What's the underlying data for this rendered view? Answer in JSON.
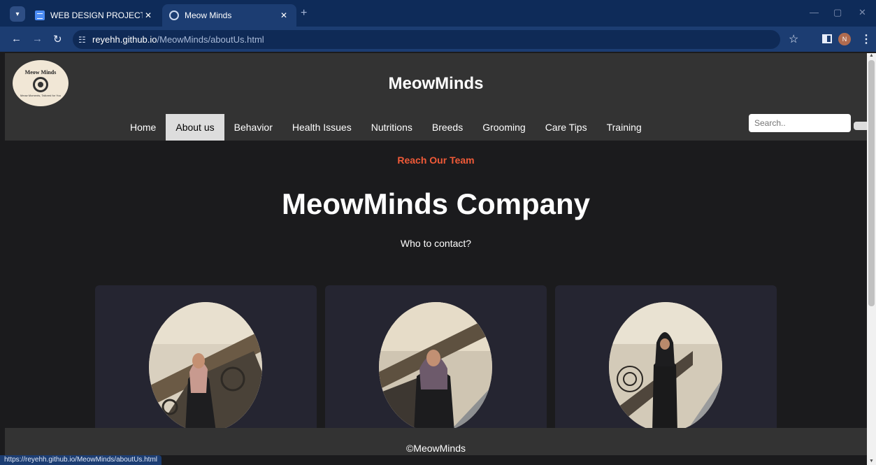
{
  "browser": {
    "tabs": [
      {
        "title": "WEB DESIGN PROJECT REPORT",
        "icon": "docs-icon",
        "active": false
      },
      {
        "title": "Meow Minds",
        "icon": "globe-icon",
        "active": true
      }
    ],
    "url_domain": "reyehh.github.io",
    "url_path": "/MeowMinds/aboutUs.html",
    "profile_initial": "N",
    "status_url": "https://reyehh.github.io/MeowMinds/aboutUs.html"
  },
  "site": {
    "title": "MeowMinds",
    "logo": {
      "top": "Meow Minds",
      "tagline": "Meow Moments, Tailored for You"
    },
    "nav": [
      "Home",
      "About us",
      "Behavior",
      "Health Issues",
      "Nutritions",
      "Breeds",
      "Grooming",
      "Care Tips",
      "Training"
    ],
    "nav_active": "About us",
    "search_placeholder": "Search.."
  },
  "main": {
    "kicker": "Reach Our Team",
    "heading": "MeowMinds Company",
    "subheading": "Who to contact?"
  },
  "team": [
    {
      "photo": "team-member-1-photo"
    },
    {
      "photo": "team-member-2-photo"
    },
    {
      "photo": "team-member-3-photo"
    }
  ],
  "footer": {
    "text": "©MeowMinds"
  },
  "colors": {
    "accent": "#f05a38",
    "header_bg": "#333333",
    "page_bg": "#1b1b1d",
    "card_bg": "#252531"
  }
}
